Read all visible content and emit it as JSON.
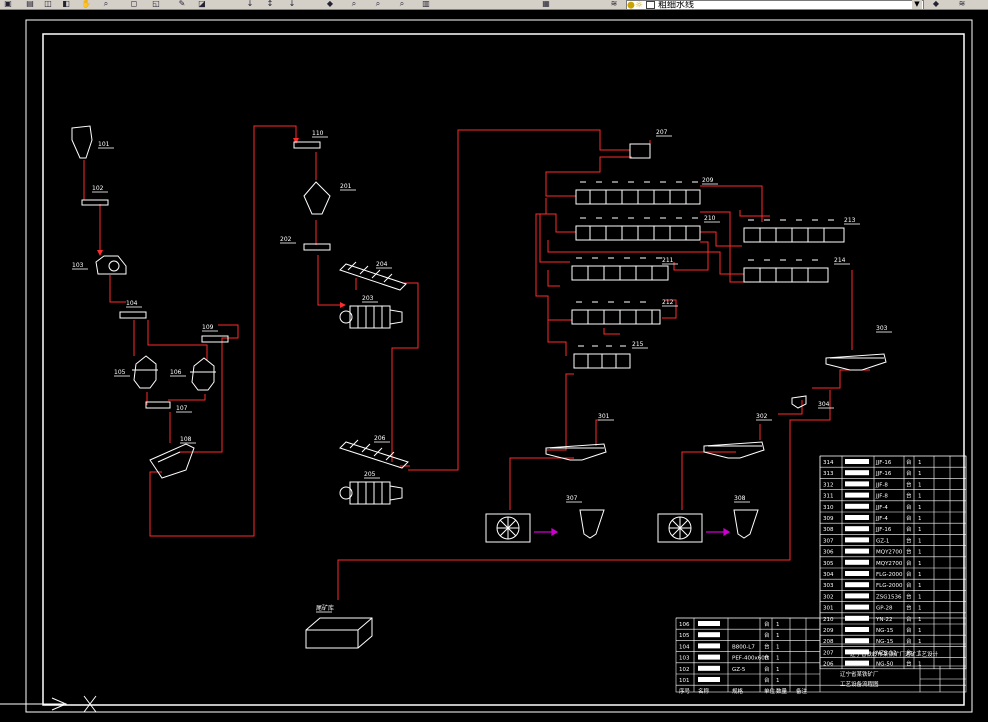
{
  "toolbar": {
    "layer_name": "粗细水线",
    "icons": [
      "save-icon",
      "print-icon",
      "preview-icon",
      "publish-icon",
      "pan-icon",
      "zoom-realtime-icon",
      "zoom-window-icon",
      "zoom-previous-icon",
      "properties-icon",
      "design-center-icon",
      "tool-palette-icon",
      "markup-icon",
      "quickcalc-icon",
      "layer-manager-icon",
      "layer-state-icon",
      "bulb-icon",
      "sun-icon",
      "lock-icon",
      "color-icon"
    ]
  },
  "diagram": {
    "units": {
      "hopper": "101",
      "feeder_1": "102",
      "crusher": "103",
      "conveyor_1": "104",
      "cone_1": "105",
      "cone_2": "106",
      "conveyor_2": "107",
      "screen": "108",
      "conveyor_3": "109",
      "conveyor_4": "110",
      "fine_bin": "201",
      "conveyor_5": "202",
      "classifier_1": "204",
      "mill_1": "203",
      "classifier_2": "206",
      "mill_2": "205",
      "flotation_1": "209",
      "flotation_2": "210",
      "flotation_3": "211",
      "flotation_4": "212",
      "flotation_5": "213",
      "flotation_6": "214",
      "flotation_7": "215",
      "pump_box": "207",
      "thickener_1": "301",
      "thickener_2": "302",
      "thickener_3": "303",
      "filter_pump": "304",
      "filter_1": "305",
      "filter_2": "306",
      "conc_bin_1": "307",
      "conc_bin_2": "308",
      "tailings": "尾矿库"
    },
    "table_right": {
      "rows": [
        {
          "no": "314",
          "spec": "JJF-16",
          "unit": "台",
          "qty": "1"
        },
        {
          "no": "313",
          "spec": "JJF-16",
          "unit": "台",
          "qty": "1"
        },
        {
          "no": "312",
          "spec": "JJF-8",
          "unit": "台",
          "qty": "1"
        },
        {
          "no": "311",
          "spec": "JJF-8",
          "unit": "台",
          "qty": "1"
        },
        {
          "no": "310",
          "spec": "JJF-4",
          "unit": "台",
          "qty": "1"
        },
        {
          "no": "309",
          "spec": "JJF-4",
          "unit": "台",
          "qty": "1"
        },
        {
          "no": "308",
          "spec": "JJF-16",
          "unit": "台",
          "qty": "1"
        },
        {
          "no": "307",
          "spec": "GZ-1",
          "unit": "台",
          "qty": "1"
        },
        {
          "no": "306",
          "spec": "MQY2700",
          "unit": "台",
          "qty": "1"
        },
        {
          "no": "305",
          "spec": "MQY2700",
          "unit": "台",
          "qty": "1"
        },
        {
          "no": "304",
          "spec": "FLG-2000",
          "unit": "台",
          "qty": "1"
        },
        {
          "no": "303",
          "spec": "FLG-2000",
          "unit": "台",
          "qty": "1"
        },
        {
          "no": "302",
          "spec": "ZSG1536",
          "unit": "台",
          "qty": "1"
        },
        {
          "no": "301",
          "spec": "GP-28",
          "unit": "台",
          "qty": "1"
        },
        {
          "no": "210",
          "spec": "YN-22",
          "unit": "台",
          "qty": "1"
        },
        {
          "no": "209",
          "spec": "NG-15",
          "unit": "台",
          "qty": "1"
        },
        {
          "no": "208",
          "spec": "NG-15",
          "unit": "台",
          "qty": "1"
        },
        {
          "no": "207",
          "spec": "NZS-12",
          "unit": "台",
          "qty": "1"
        },
        {
          "no": "206",
          "spec": "NG-50",
          "unit": "台",
          "qty": "1"
        }
      ]
    },
    "table_bottom": {
      "rows": [
        {
          "no": "106",
          "spec": "",
          "unit": "台",
          "qty": "1"
        },
        {
          "no": "105",
          "spec": "",
          "unit": "台",
          "qty": "1"
        },
        {
          "no": "104",
          "spec": "B800-L7",
          "unit": "台",
          "qty": "1"
        },
        {
          "no": "103",
          "spec": "PEF-400x600",
          "unit": "台",
          "qty": "1"
        },
        {
          "no": "102",
          "spec": "GZ-5",
          "unit": "台",
          "qty": "1"
        },
        {
          "no": "101",
          "spec": "",
          "unit": "台",
          "qty": "1"
        }
      ],
      "footer": [
        "序号",
        "名称",
        "规格",
        "单位",
        "数量",
        "备注"
      ]
    },
    "title_block": {
      "line1": "辽宁省铁岭市某铁矿厂选矿工艺设计",
      "line2": "辽宁省某铁矿厂",
      "line3": "工艺设备流程图"
    }
  },
  "colors": {
    "background": "#000000",
    "line": "#ffffff",
    "flow": "#ff2a2a",
    "accent": "#cc00cc"
  }
}
